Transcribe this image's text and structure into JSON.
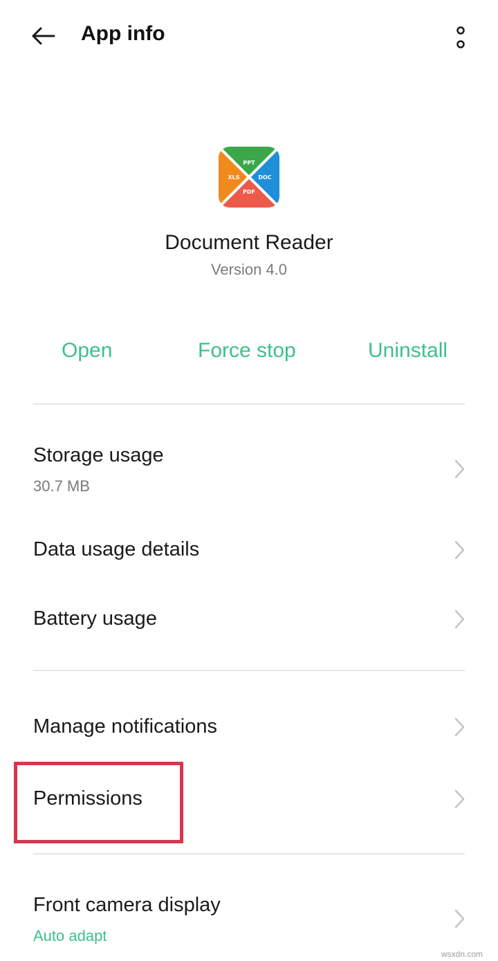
{
  "header": {
    "title": "App info",
    "back_icon": "arrow-left-icon",
    "more_icon": "more-vertical-icon"
  },
  "app": {
    "icon": "document-reader-app-icon",
    "icon_labels": {
      "ppt": "PPT",
      "doc": "DOC",
      "xls": "XLS",
      "pdf": "PDF"
    },
    "name": "Document Reader",
    "version": "Version 4.0"
  },
  "actions": {
    "open": "Open",
    "force_stop": "Force stop",
    "uninstall": "Uninstall"
  },
  "settings": {
    "storage": {
      "title": "Storage usage",
      "subtitle": "30.7 MB"
    },
    "data_usage": {
      "title": "Data usage details"
    },
    "battery": {
      "title": "Battery usage"
    },
    "notifications": {
      "title": "Manage notifications"
    },
    "permissions": {
      "title": "Permissions"
    },
    "front_camera": {
      "title": "Front camera display",
      "subtitle": "Auto adapt"
    }
  },
  "watermark": "wsxdn.com",
  "colors": {
    "accent": "#3ec08a",
    "highlight": "#d8364f",
    "icon_green": "#3aa84a",
    "icon_blue": "#1e8fd8",
    "icon_orange": "#f08a1c",
    "icon_red": "#ee5a4a"
  }
}
